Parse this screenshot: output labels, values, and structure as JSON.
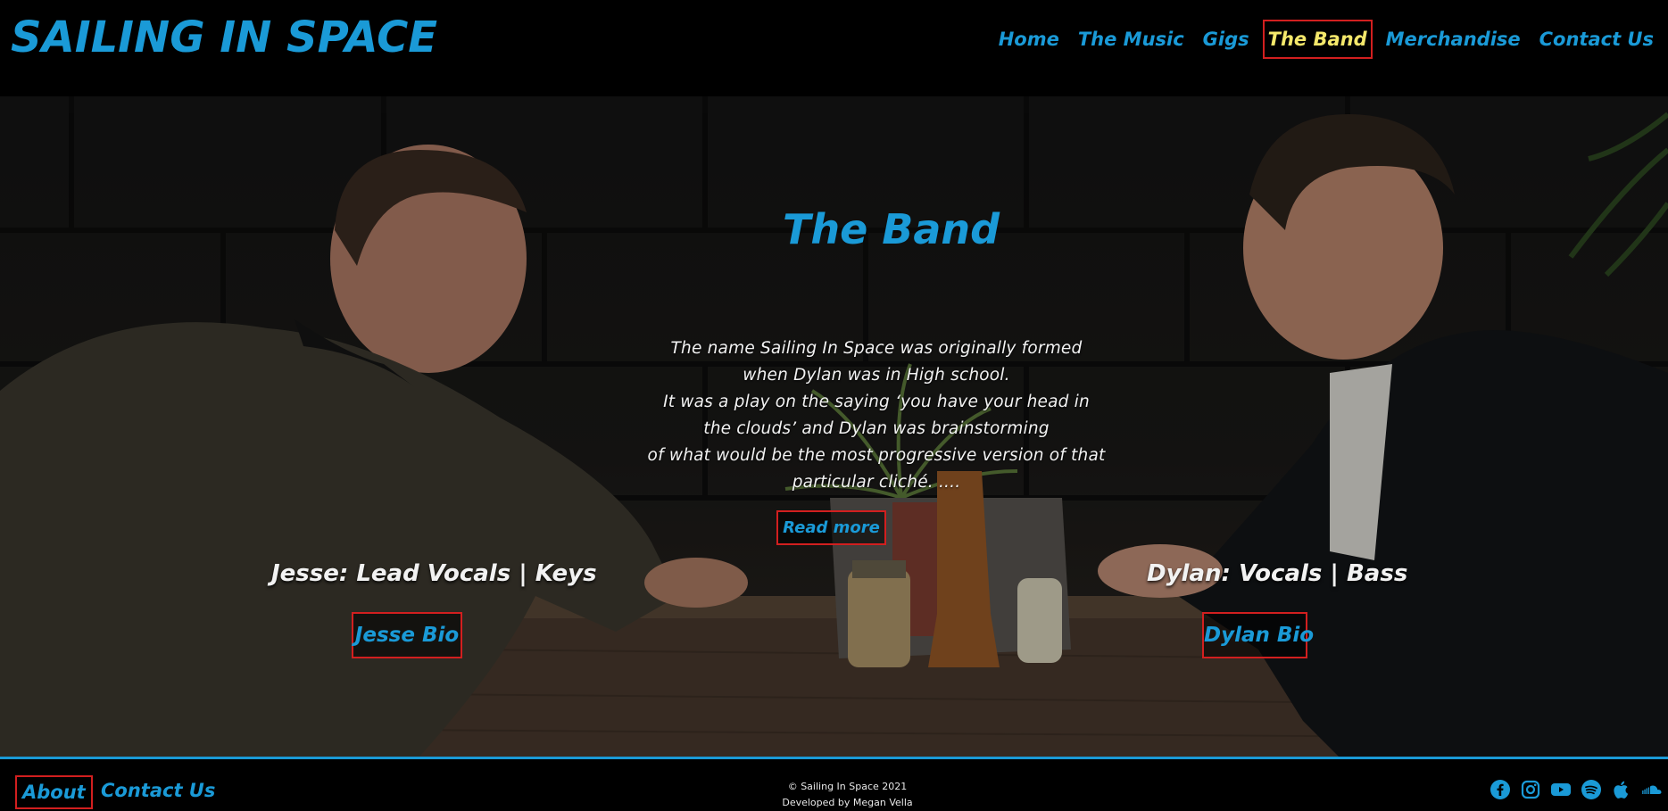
{
  "site": {
    "logo": "SAILING IN SPACE"
  },
  "nav": {
    "items": [
      {
        "label": "Home",
        "active": false
      },
      {
        "label": "The Music",
        "active": false
      },
      {
        "label": "Gigs",
        "active": false
      },
      {
        "label": "The Band",
        "active": true
      },
      {
        "label": "Merchandise",
        "active": false
      },
      {
        "label": "Contact Us",
        "active": false
      }
    ]
  },
  "hero": {
    "title": "The Band",
    "intro_lines": [
      "The name Sailing In Space was originally formed",
      "when Dylan was in High school.",
      "It was a play on the saying ‘you have your head in",
      "the clouds’ and Dylan was brainstorming",
      "of what would be the most progressive version of that",
      "particular cliché. ...."
    ],
    "read_more": "Read more",
    "members": [
      {
        "name": "Jesse: Lead Vocals | Keys",
        "bio_label": "Jesse Bio"
      },
      {
        "name": "Dylan: Vocals | Bass",
        "bio_label": "Dylan Bio"
      }
    ]
  },
  "footer": {
    "links": [
      "About",
      "Contact Us"
    ],
    "copyright": "© Sailing In Space 2021",
    "developer": "Developed by Megan Vella",
    "social_icons": [
      "facebook-icon",
      "instagram-icon",
      "youtube-icon",
      "spotify-icon",
      "apple-icon",
      "soundcloud-icon"
    ]
  },
  "colors": {
    "accent": "#1a9ad7",
    "active_nav": "#f4e86b",
    "highlight_border": "#d21f1f",
    "background": "#000000"
  }
}
